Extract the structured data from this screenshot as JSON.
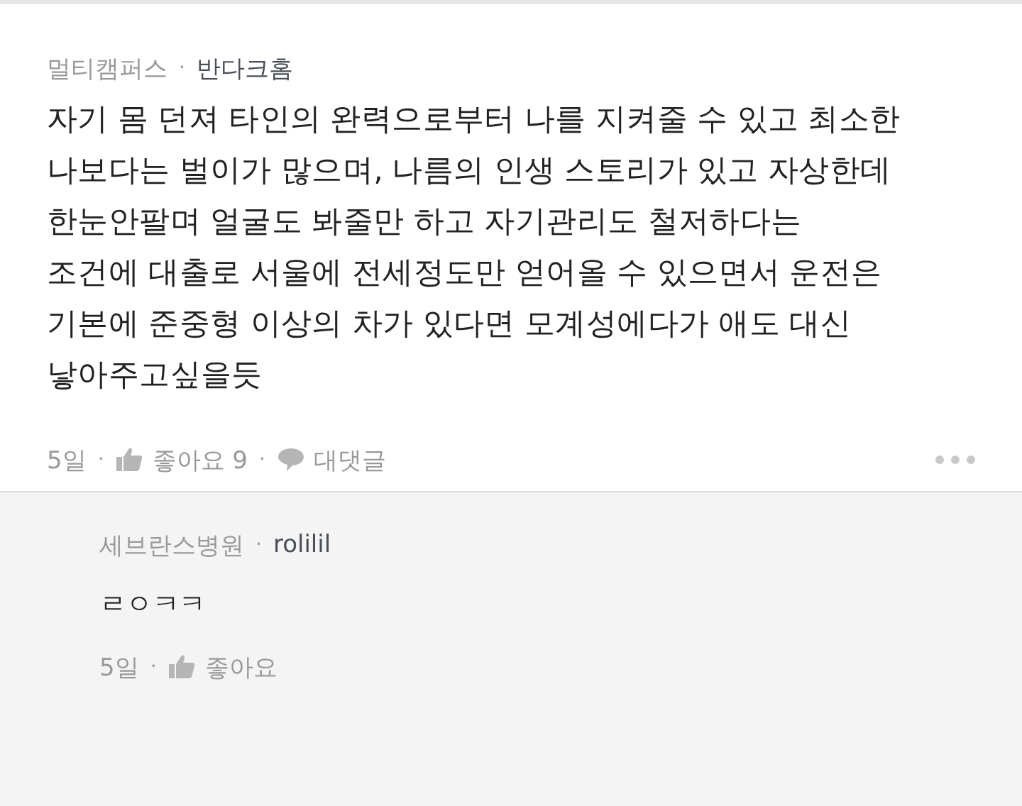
{
  "comment": {
    "group": "멀티캠퍼스",
    "separator": "·",
    "author": "반다크홈",
    "body": "자기 몸 던져 타인의 완력으로부터 나를 지켜줄 수 있고 최소한\n나보다는 벌이가 많으며, 나름의 인생 스토리가 있고 자상한데\n한눈안팔며 얼굴도 봐줄만 하고 자기관리도 철저하다는\n조건에 대출로 서울에 전세정도만 얻어올 수 있으면서 운전은\n기본에 준중형 이상의 차가 있다면 모계성에다가 애도 대신\n낳아주고싶을듯",
    "actions": [
      {
        "kind": "time",
        "label": "5일"
      },
      {
        "kind": "like",
        "label": "좋아요 9"
      },
      {
        "kind": "reply",
        "label": "대댓글"
      }
    ],
    "more_menu": true
  },
  "reply": {
    "group": "세브란스병원",
    "separator": "·",
    "author": "rolilil",
    "body": "ㄹㅇㅋㅋ",
    "actions": [
      {
        "kind": "time",
        "label": "5일"
      },
      {
        "kind": "like",
        "label": "좋아요"
      }
    ]
  }
}
